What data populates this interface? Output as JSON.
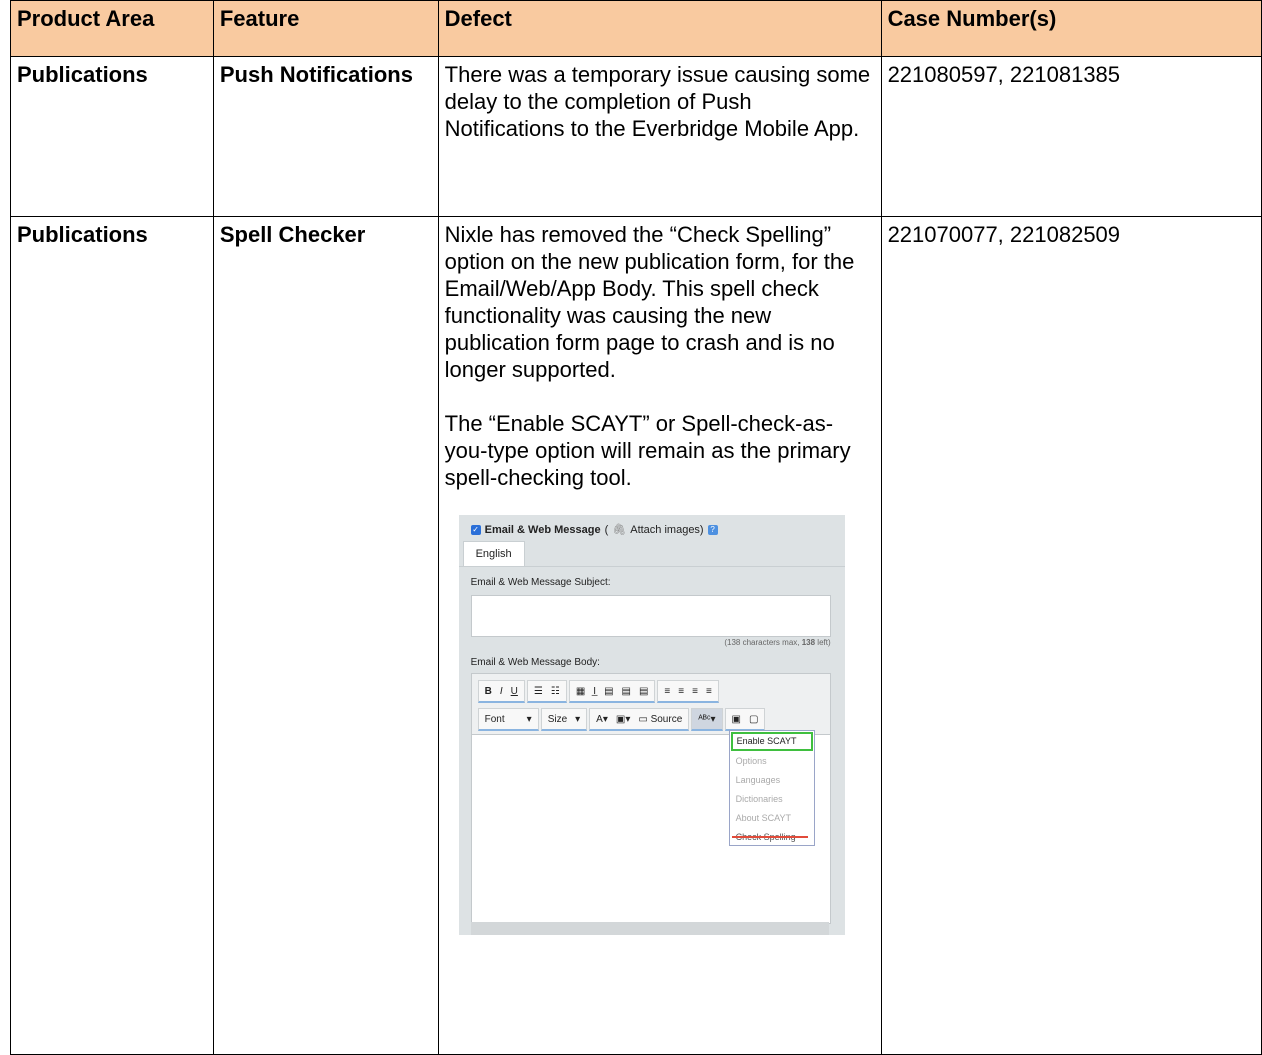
{
  "table": {
    "headers": [
      "Product Area",
      "Feature",
      "Defect",
      "Case Number(s)"
    ],
    "rows": [
      {
        "product_area": "Publications",
        "feature": "Push Notifications",
        "defect": "There was a temporary issue causing some delay to the completion of Push Notifications to the Everbridge Mobile App.",
        "cases": "221080597, 221081385"
      },
      {
        "product_area": "Publications",
        "feature": "Spell Checker",
        "defect_p1": "Nixle has removed the “Check Spelling” option on the new publication form, for the Email/Web/App Body.  This spell check functionality was causing the new publication form page to crash and is no longer supported.",
        "defect_p2": "The “Enable SCAYT” or Spell-check-as-you-type option will remain as the primary spell-checking tool.",
        "cases": "221070077, 221082509"
      }
    ]
  },
  "screenshot": {
    "section_title": "Email & Web Message",
    "attach": "(",
    "attach_text": "Attach images)",
    "tab": "English",
    "subject_label": "Email & Web Message Subject:",
    "char_note_pre": "(138 characters max, ",
    "char_note_bold": "138",
    "char_note_post": " left)",
    "body_label": "Email & Web Message Body:",
    "toolbar_font": "Font",
    "toolbar_size": "Size",
    "toolbar_source": "Source",
    "menu": [
      "Enable SCAYT",
      "Options",
      "Languages",
      "Dictionaries",
      "About SCAYT",
      "Check Spelling"
    ]
  }
}
